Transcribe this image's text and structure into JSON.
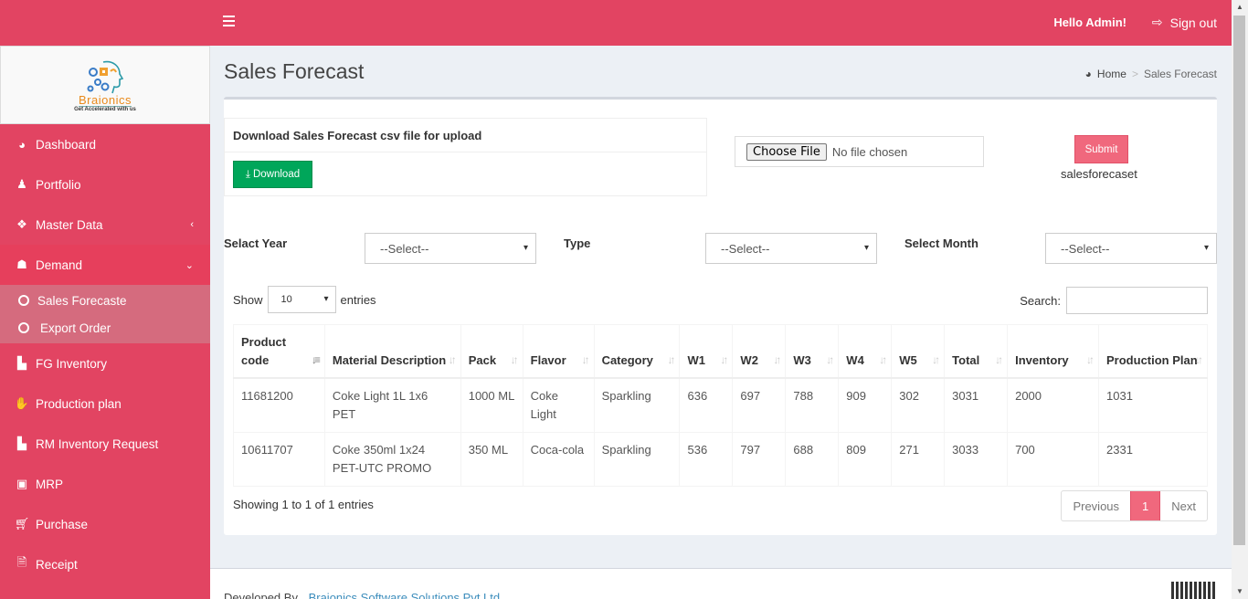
{
  "brand": {
    "name": "Braionics",
    "tagline": "Get Accelerated with us"
  },
  "sidebar": {
    "items": [
      {
        "label": "Dashboard",
        "icon": "dashboard-icon"
      },
      {
        "label": "Portfolio",
        "icon": "user-icon"
      },
      {
        "label": "Master Data",
        "icon": "cubes-icon",
        "chevron": "‹"
      },
      {
        "label": "Demand",
        "icon": "users-icon",
        "chevron": "⌄"
      },
      {
        "label": "FG Inventory",
        "icon": "industry-icon"
      },
      {
        "label": "Production plan",
        "icon": "handshake-icon"
      },
      {
        "label": "RM Inventory Request",
        "icon": "industry-icon"
      },
      {
        "label": "MRP",
        "icon": "money-icon"
      },
      {
        "label": "Purchase",
        "icon": "cart-icon"
      },
      {
        "label": "Receipt",
        "icon": "file-icon"
      }
    ],
    "demand_submenu": [
      {
        "label": "Sales Forecaste"
      },
      {
        "label": "Export Order"
      }
    ]
  },
  "topbar": {
    "greeting": "Hello Admin!",
    "signout_label": "Sign out"
  },
  "page": {
    "title": "Sales Forecast",
    "breadcrumb": {
      "home": "Home",
      "current": "Sales Forecast"
    }
  },
  "download_panel": {
    "heading": "Download Sales Forecast csv file for upload",
    "button_label": "Download"
  },
  "upload": {
    "choose_file_label": "Choose File",
    "file_status": "No file chosen",
    "submit_label": "Submit",
    "submit_caption": "salesforecaset"
  },
  "filters": {
    "year_label": "Selact Year",
    "year_value": "--Select--",
    "type_label": "Type",
    "type_value": "--Select--",
    "month_label": "Select Month",
    "month_value": "--Select--"
  },
  "table_controls": {
    "show_label": "Show",
    "page_length": "10",
    "entries_label": "entries",
    "search_label": "Search:",
    "search_value": ""
  },
  "table": {
    "columns": [
      "Product code",
      "Material Description",
      "Pack",
      "Flavor",
      "Category",
      "W1",
      "W2",
      "W3",
      "W4",
      "W5",
      "Total",
      "Inventory",
      "Production Plan"
    ],
    "rows": [
      [
        "11681200",
        "Coke Light 1L 1x6 PET",
        "1000 ML",
        "Coke Light",
        "Sparkling",
        "636",
        "697",
        "788",
        "909",
        "302",
        "3031",
        "2000",
        "1031"
      ],
      [
        "10611707",
        "Coke 350ml 1x24 PET-UTC PROMO",
        "350 ML",
        "Coca-cola",
        "Sparkling",
        "536",
        "797",
        "688",
        "809",
        "271",
        "3033",
        "700",
        "2331"
      ]
    ]
  },
  "pagination": {
    "info": "Showing 1 to 1 of 1 entries",
    "previous": "Previous",
    "current_page": "1",
    "next": "Next"
  },
  "footer": {
    "developed_by": "Developed By",
    "company": "Braionics Software Solutions Pvt Ltd"
  },
  "colors": {
    "brand": "#e24462",
    "submit": "#f0687d",
    "download": "#00a65a"
  }
}
